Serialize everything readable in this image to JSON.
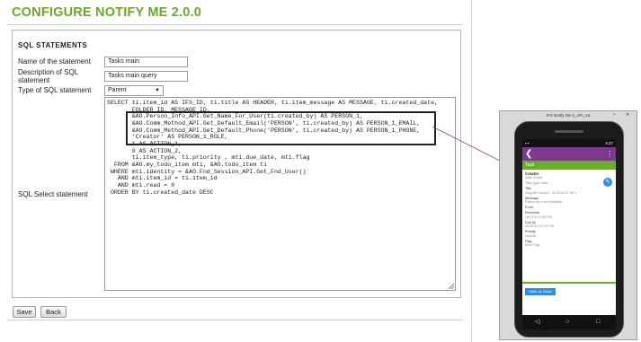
{
  "page": {
    "title": "CONFIGURE NOTIFY ME 2.0.0",
    "section_title": "SQL STATEMENTS"
  },
  "form": {
    "name_label": "Name of the statement",
    "name_value": "Tasks main",
    "desc_label": "Description of SQL statement",
    "desc_value": "Tasks main query",
    "type_label": "Type of SQL statement",
    "type_value": "Parent",
    "sql_label": "SQL Select statement",
    "sql_text": "SELECT ti.item_id AS IFS_ID, ti.title AS HEADER, ti.item_message AS MESSAGE, ti.created_date,\n       FOLDER_ID, MESSAGE_ID,\n       &AO.Person_Info_API.Get_Name_For_User(ti.created_by) AS PERSON_1,\n       &AO.Comm_Method_API.Get_Default_Email('PERSON', ti.created_by) AS PERSON_1_EMAIL,\n       &AO.Comm_Method_API.Get_Default_Phone('PERSON', ti.created_by) AS PERSON_1_PHONE,\n       'Creator' AS PERSON_1_ROLE,\n       1 AS ACTION_1,\n       0 AS ACTION_2,\n       ti.item_type, ti.priority , mti.due_date, mti.flag\n  FROM &AO.my_todo_item mti, &AO.todo_item ti\n WHERE mti.identity = &AO.Fnd_Session_API.Get_Fnd_User()\n   AND mti.item_id = ti.item_id\n   AND mti.read = 0\n ORDER BY ti.created_date DESC"
  },
  "buttons": {
    "save": "Save",
    "back": "Back"
  },
  "emulator": {
    "window_title": "IFS Notify Me 2_API_15",
    "time": "4:37",
    "toolbar_back_glyph": "❮",
    "toolbar_menu_glyph": "⋮",
    "subheader": "Task",
    "creator_label": "Creator",
    "creator_value": "Alain Priest",
    "task_type": "Task type: task",
    "fields": [
      {
        "label": "Title",
        "value": "Supplier invoice - ID 2014 07 08 1"
      },
      {
        "label": "Message",
        "value": "Follow up from NotifyMe"
      },
      {
        "label": "From",
        "value": ""
      },
      {
        "label": "Received",
        "value": "10/17/14 2:36 PM"
      },
      {
        "label": "Due by",
        "value": "10/20/14 12:40 PM"
      },
      {
        "label": "Priority",
        "value": "Normal"
      },
      {
        "label": "Flag",
        "value": "Blue Flag"
      }
    ],
    "mark_button": "Mark as Read",
    "fab_glyph": "✎"
  },
  "colors": {
    "title_green": "#6aa82a",
    "toolbar_purple": "#7c3a8f",
    "accent_blue": "#2f8fe0"
  }
}
